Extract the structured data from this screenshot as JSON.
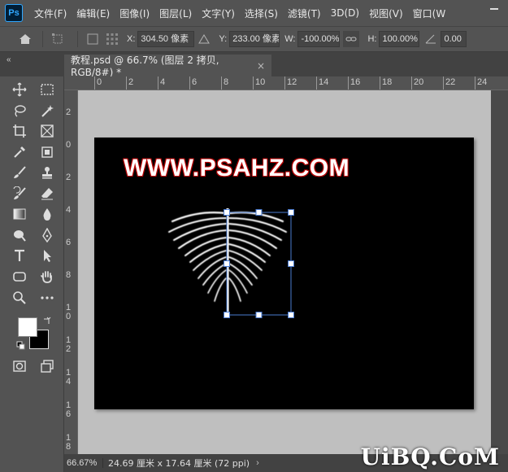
{
  "app": {
    "logo": "Ps"
  },
  "menu": [
    "文件(F)",
    "编辑(E)",
    "图像(I)",
    "图层(L)",
    "文字(Y)",
    "选择(S)",
    "滤镜(T)",
    "3D(D)",
    "视图(V)",
    "窗口(W"
  ],
  "options": {
    "x_label": "X:",
    "x_value": "304.50 像素",
    "y_label": "Y:",
    "y_value": "233.00 像素",
    "w_label": "W:",
    "w_value": "-100.00%",
    "h_label": "H:",
    "h_value": "100.00%",
    "angle_value": "0.00"
  },
  "tab": {
    "title": "教程.psd @ 66.7% (图层 2 拷贝, RGB/8#) *",
    "close": "×"
  },
  "ruler": {
    "h_labels": [
      "0",
      "2",
      "4",
      "6",
      "8",
      "10",
      "12",
      "14",
      "16",
      "18",
      "20",
      "22",
      "24"
    ],
    "v_labels": [
      "2",
      "0",
      "2",
      "4",
      "6",
      "8",
      "1\n0",
      "1\n2",
      "1\n4",
      "1\n6",
      "1\n8"
    ]
  },
  "canvas": {
    "text": "WWW.PSAHZ.COM",
    "text_outline_color": "#b00000"
  },
  "status": {
    "zoom": "66.67%",
    "docsize": "24.69 厘米 x 17.64 厘米 (72 ppi)",
    "chevron": "›"
  },
  "watermark": "UiBQ.CoM",
  "colors": {
    "foreground": "#ffffff",
    "background": "#000000",
    "ui_bg": "#535353"
  }
}
